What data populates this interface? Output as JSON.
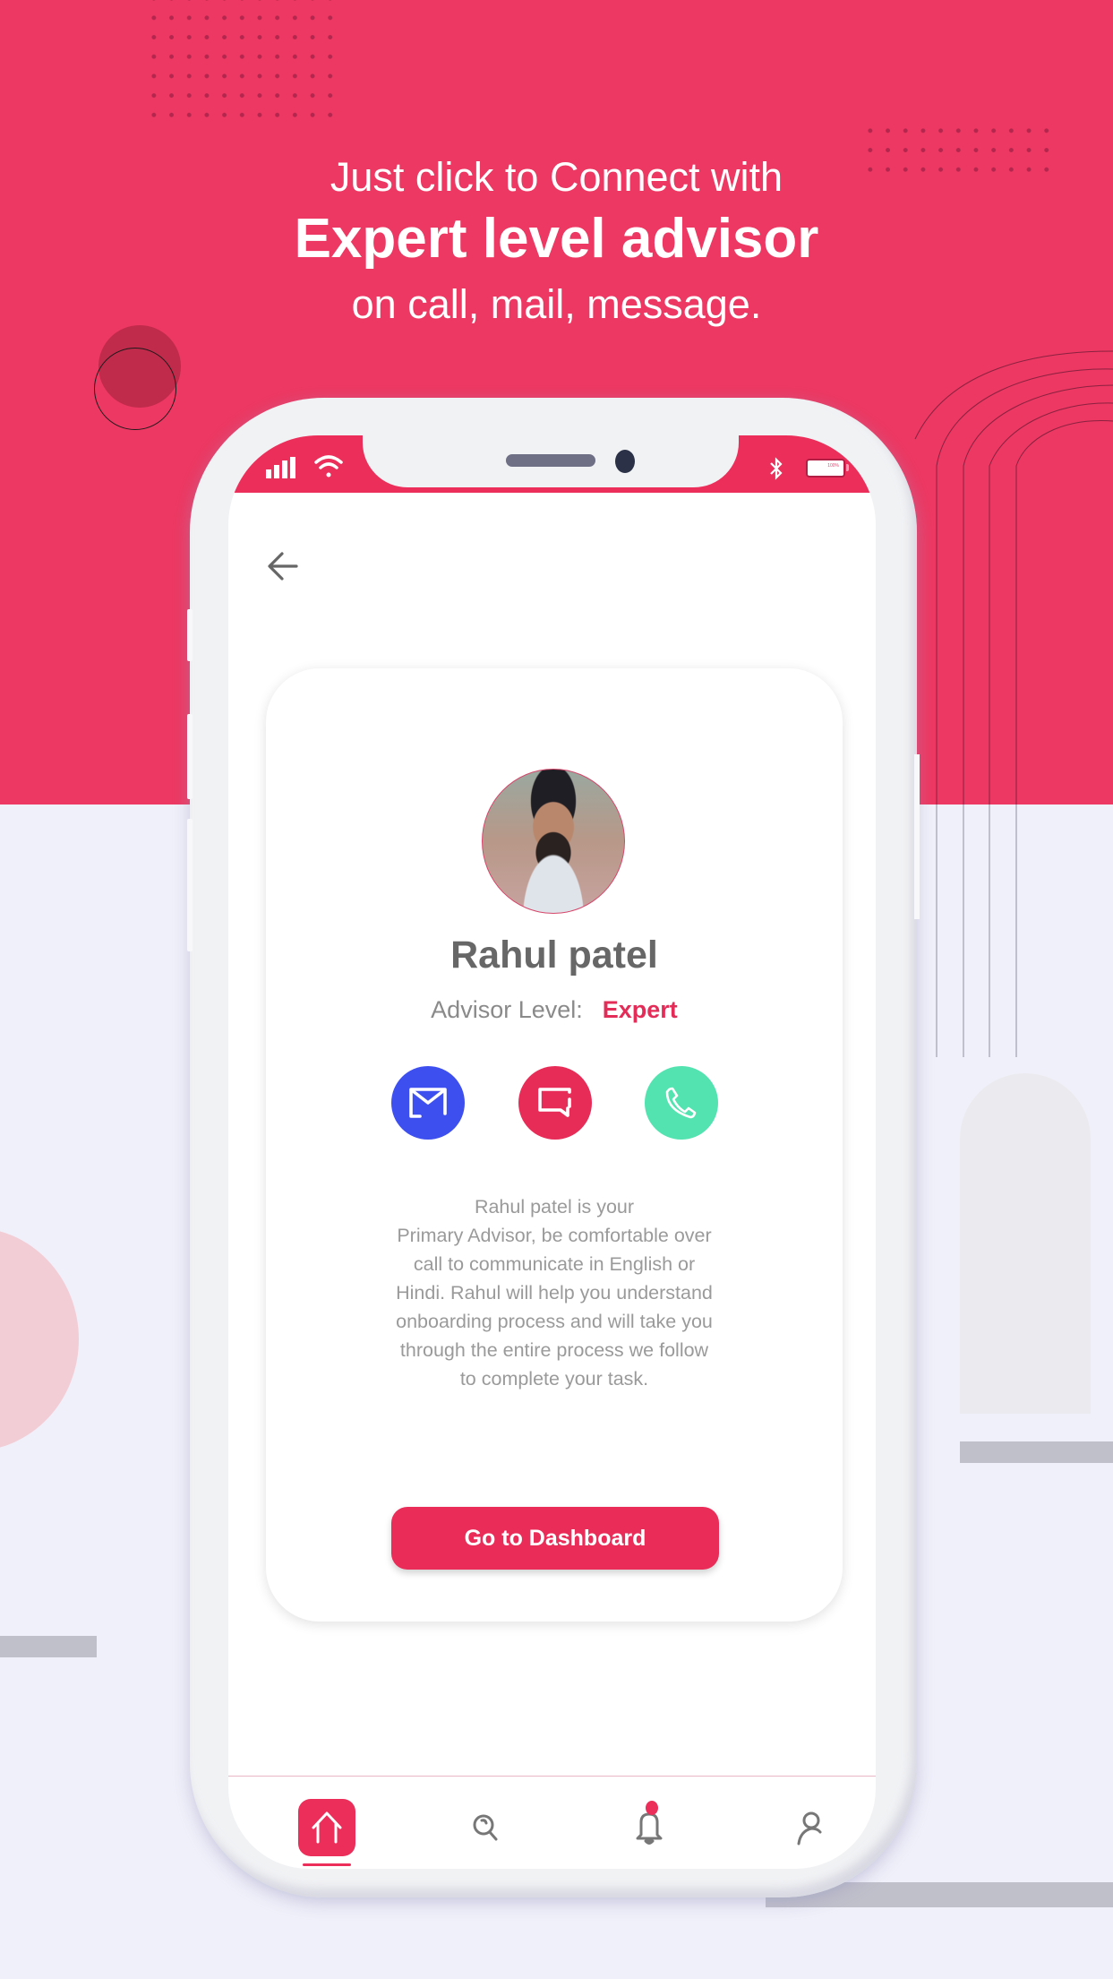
{
  "theme": {
    "primary": "#ec2e5a",
    "mail_button": "#3e4ff0",
    "message_button": "#e82c58",
    "call_button": "#52e3b0",
    "background_top": "#ec3862",
    "background_bottom": "#f0f0fa"
  },
  "headline": {
    "line1": "Just click to Connect with",
    "line2": "Expert level advisor",
    "line3": "on call, mail, message."
  },
  "status_bar": {
    "icons": [
      "signal-icon",
      "wifi-icon",
      "bluetooth-icon",
      "battery-icon"
    ],
    "battery_level": "100%"
  },
  "nav": {
    "back_icon": "arrow-left-icon"
  },
  "advisor": {
    "name": "Rahul patel",
    "level_label": "Advisor Level:",
    "level_value": "Expert",
    "actions": [
      {
        "label": "Mail",
        "icon": "mail-icon"
      },
      {
        "label": "Message",
        "icon": "chat-icon"
      },
      {
        "label": "Call",
        "icon": "phone-icon"
      }
    ],
    "description_lines": [
      "Rahul patel is your",
      "Primary Advisor, be comfortable over",
      "call to communicate in English or",
      "Hindi. Rahul will help you understand",
      "onboarding process and will take you",
      "through the entire process we follow",
      "to complete your task."
    ],
    "cta_label": "Go to Dashboard"
  },
  "tabbar": {
    "items": [
      {
        "name": "home",
        "icon": "home-icon",
        "active": true
      },
      {
        "name": "search",
        "icon": "search-icon",
        "active": false
      },
      {
        "name": "notifications",
        "icon": "bell-icon",
        "active": false,
        "badge": true
      },
      {
        "name": "profile",
        "icon": "user-icon",
        "active": false
      }
    ]
  }
}
